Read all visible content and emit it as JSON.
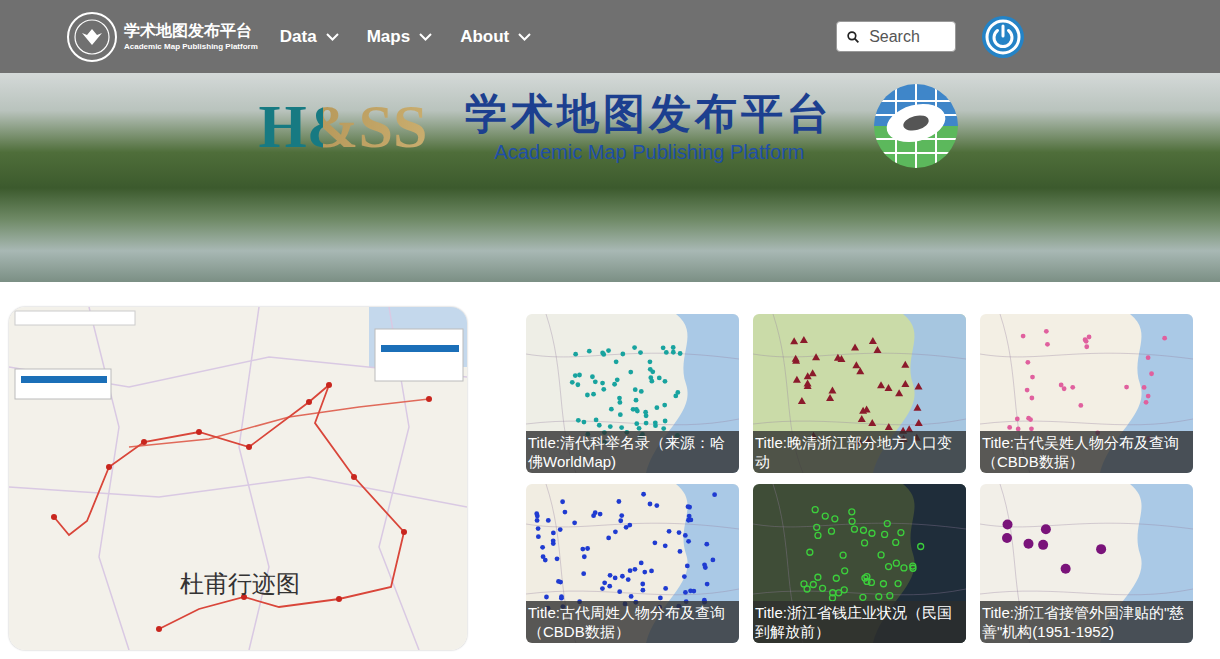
{
  "header": {
    "logo": {
      "title": "学术地图发布平台",
      "subtitle": "Academic Map Publishing Platform"
    },
    "nav": [
      {
        "label": "Data"
      },
      {
        "label": "Maps"
      },
      {
        "label": "About"
      }
    ],
    "search": {
      "placeholder": "Search"
    }
  },
  "banner": {
    "logo": "H&SS",
    "title": "学术地图发布平台",
    "subtitle": "Academic Map Publishing Platform"
  },
  "featured": {
    "caption": "杜甫行迹图"
  },
  "maps": [
    {
      "title": "Title:清代科举名录（来源：哈佛WorldMap)",
      "kind": "dot",
      "color": "#18a39f"
    },
    {
      "title": "Title:晚清浙江部分地方人口变动",
      "kind": "triangle",
      "color": "#8b1a2b"
    },
    {
      "title": "Title:古代吴姓人物分布及查询（CBDB数据）",
      "kind": "dot",
      "color": "#e0609e"
    },
    {
      "title": "Title:古代周姓人物分布及查询（CBDB数据）",
      "kind": "dot",
      "color": "#1f3bd1"
    },
    {
      "title": "Title:浙江省钱庄业状况（民国到解放前）",
      "kind": "ring",
      "color": "#3ccf3c"
    },
    {
      "title": "Title:浙江省接管外国津贴的\"慈善\"机构(1951-1952)",
      "kind": "disc",
      "color": "#7a137a"
    }
  ]
}
